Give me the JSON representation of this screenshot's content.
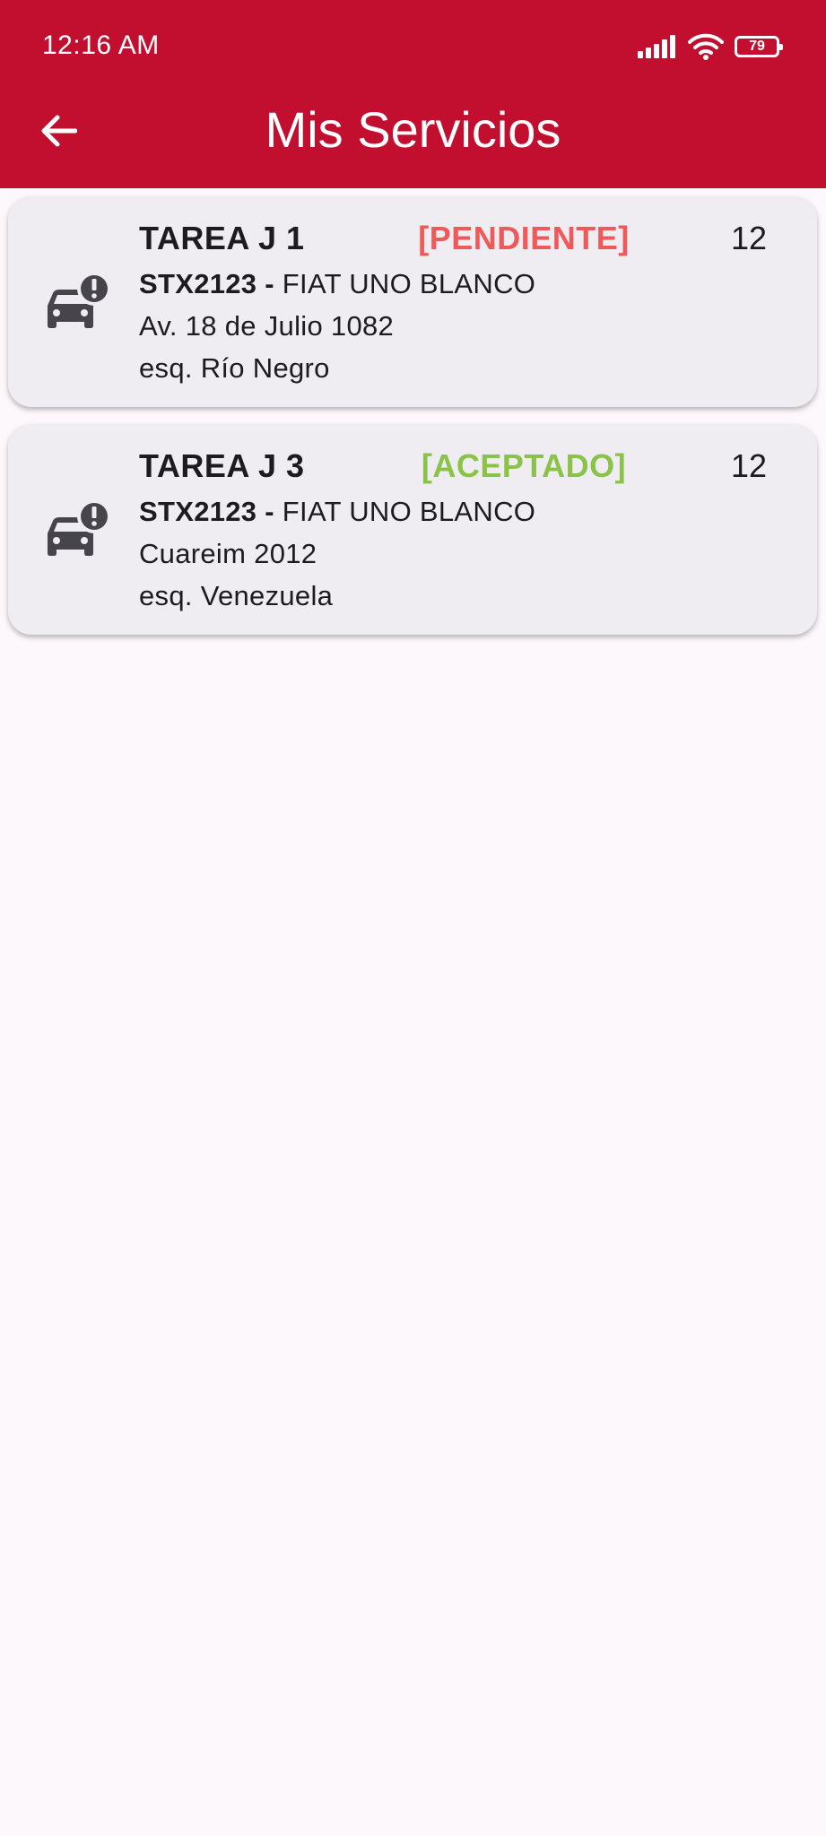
{
  "status_bar": {
    "time": "12:16 AM",
    "battery": "79",
    "icons": [
      "signal-icon",
      "wifi-icon",
      "battery-icon"
    ]
  },
  "appbar": {
    "title": "Mis Servicios",
    "back_icon": "arrow-back-icon",
    "color": "#c20f30"
  },
  "colors": {
    "pendiente": "#ee5a5a",
    "aceptado": "#8bc34a",
    "card_bg": "#f0edf2",
    "icon": "#47454c"
  },
  "services": [
    {
      "title": "TAREA J 1",
      "status": "[PENDIENTE]",
      "status_color": "#ee5a5a",
      "count": "12",
      "plate": "STX2123 -",
      "vehicle": " FIAT UNO BLANCO",
      "address": "Av. 18 de Julio 1082",
      "corner": "esq. Río Negro",
      "icon": "car-alert-icon"
    },
    {
      "title": "TAREA J 3",
      "status": "[ACEPTADO]",
      "status_color": "#8bc34a",
      "count": "12",
      "plate": "STX2123 -",
      "vehicle": " FIAT UNO BLANCO",
      "address": "Cuareim 2012",
      "corner": "esq. Venezuela",
      "icon": "car-alert-icon"
    }
  ]
}
